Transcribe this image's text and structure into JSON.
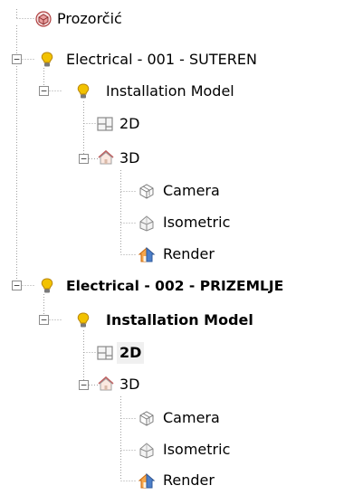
{
  "tree": {
    "root": {
      "label": "Prozorčić",
      "icon": "cube-icon"
    },
    "level1": {
      "label": "Electrical - 001 - SUTEREN",
      "icon": "lightbulb-icon",
      "expander": "minus",
      "model": {
        "label": "Installation Model",
        "icon": "lightbulb-icon",
        "expander": "minus",
        "view2d": {
          "label": "2D",
          "icon": "floor-plan-icon"
        },
        "view3d": {
          "label": "3D",
          "icon": "house-icon",
          "expander": "minus",
          "camera": {
            "label": "Camera",
            "icon": "camera-view-icon"
          },
          "isometric": {
            "label": "Isometric",
            "icon": "isometric-house-icon"
          },
          "render": {
            "label": "Render",
            "icon": "render-house-icon"
          }
        }
      }
    },
    "level2": {
      "label": "Electrical - 002 - PRIZEMLJE",
      "icon": "lightbulb-icon",
      "expander": "minus",
      "model": {
        "label": "Installation Model",
        "icon": "lightbulb-icon",
        "expander": "minus",
        "view2d": {
          "label": "2D",
          "icon": "floor-plan-icon"
        },
        "view3d": {
          "label": "3D",
          "icon": "house-icon",
          "expander": "minus",
          "camera": {
            "label": "Camera",
            "icon": "camera-view-icon"
          },
          "isometric": {
            "label": "Isometric",
            "icon": "isometric-house-icon"
          },
          "render": {
            "label": "Render",
            "icon": "render-house-icon"
          }
        }
      }
    }
  },
  "colors": {
    "bulb": "#f2c200",
    "bulb_outline": "#b8860b",
    "line": "#a0a0a0",
    "selection": "#f0f0f0",
    "render_orange": "#f28c1b"
  }
}
